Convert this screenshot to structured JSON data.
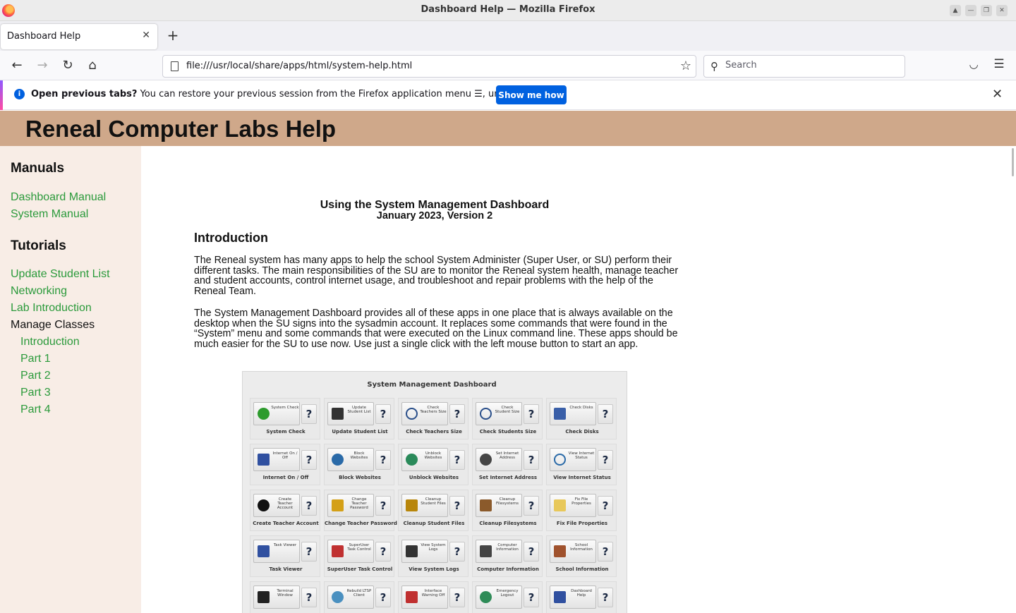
{
  "window": {
    "title": "Dashboard Help — Mozilla Firefox"
  },
  "tabs": [
    {
      "label": "Dashboard Help"
    }
  ],
  "navbar": {
    "url": "file:///usr/local/share/apps/html/system-help.html",
    "search_placeholder": "Search"
  },
  "notification": {
    "bold": "Open previous tabs?",
    "text": " You can restore your previous session from the Firefox application menu ☰, under History.",
    "button": "Show me how"
  },
  "page": {
    "banner_title": "Reneal Computer Labs Help",
    "sidebar": {
      "manuals_heading": "Manuals",
      "manuals": [
        "Dashboard Manual",
        "System Manual"
      ],
      "tutorials_heading": "Tutorials",
      "tutorials": [
        "Update Student List",
        "Networking",
        "Lab Introduction"
      ],
      "manage_classes": "Manage Classes",
      "manage_sub": [
        "Introduction",
        "Part 1",
        "Part 2",
        "Part 3",
        "Part 4"
      ]
    },
    "doc": {
      "title": "Using the System Management Dashboard",
      "subtitle": "January 2023, Version 2",
      "intro_heading": "Introduction",
      "para1": "The Reneal system has many apps to help the school System Administer (Super User, or SU) perform their different tasks.  The main responsibilities of the SU are to monitor the Reneal system health, manage teacher and student accounts, control internet usage, and troubleshoot and repair problems with the help of the Reneal Team.",
      "para2": "The System Management Dashboard provides all of these apps in one place that is always available on the desktop when the SU signs into the sysadmin account.  It replaces some commands that were found in the “System” menu and some commands that were executed on the Linux command line.  These apps should be much easier for the SU to use now.  Use just a single click with the left mouse button to start an app."
    },
    "dashboard": {
      "title": "System Management Dashboard",
      "help_glyph": "?",
      "apps": [
        {
          "button": "System Check",
          "caption": "System Check",
          "icon": "check-icon",
          "color": "#2e9b2e"
        },
        {
          "button": "Update Student List",
          "caption": "Update Student List",
          "icon": "list-icon",
          "color": "#333333"
        },
        {
          "button": "Check Teachers Size",
          "caption": "Check Teachers Size",
          "icon": "magnifier-icon",
          "color": "#2a4f8a"
        },
        {
          "button": "Check Student Size",
          "caption": "Check Students Size",
          "icon": "magnifier-icon",
          "color": "#2a4f8a"
        },
        {
          "button": "Check Disks",
          "caption": "Check Disks",
          "icon": "disk-icon",
          "color": "#3a5fa8"
        },
        {
          "button": "Internet On / Off",
          "caption": "Internet On / Off",
          "icon": "monitor-icon",
          "color": "#3050a0"
        },
        {
          "button": "Block Websites",
          "caption": "Block Websites",
          "icon": "globe-icon",
          "color": "#2a6aa8"
        },
        {
          "button": "Unblock Websites",
          "caption": "Unblock Websites",
          "icon": "globe-icon",
          "color": "#2a8a5a"
        },
        {
          "button": "Set Internet Address",
          "caption": "Set Internet Address",
          "icon": "router-icon",
          "color": "#444444"
        },
        {
          "button": "View Internet Status",
          "caption": "View Internet Status",
          "icon": "globe-search-icon",
          "color": "#2a6aa8"
        },
        {
          "button": "Create Teacher Account",
          "caption": "Create Teacher Account",
          "icon": "user-add-icon",
          "color": "#111111"
        },
        {
          "button": "Change Teacher Password",
          "caption": "Change Teacher Password",
          "icon": "lock-icon",
          "color": "#d4a017"
        },
        {
          "button": "Cleanup Student Files",
          "caption": "Cleanup Student Files",
          "icon": "broom-icon",
          "color": "#b8860b"
        },
        {
          "button": "Cleanup Filesystems",
          "caption": "Cleanup Filesystems",
          "icon": "broom-icon",
          "color": "#8b5a2b"
        },
        {
          "button": "Fix File Properties",
          "caption": "Fix File Properties",
          "icon": "file-icon",
          "color": "#e8c85a"
        },
        {
          "button": "Task Viewer",
          "caption": "Task Viewer",
          "icon": "monitor-icon",
          "color": "#3050a0"
        },
        {
          "button": "SuperUser Task Control",
          "caption": "SuperUser Task Control",
          "icon": "monitor-icon",
          "color": "#c03030"
        },
        {
          "button": "View System Logs",
          "caption": "View System Logs",
          "icon": "document-search-icon",
          "color": "#333333"
        },
        {
          "button": "Computer Information",
          "caption": "Computer Information",
          "icon": "computer-icon",
          "color": "#444444"
        },
        {
          "button": "School Information",
          "caption": "School Information",
          "icon": "document-icon",
          "color": "#a0522d"
        },
        {
          "button": "Terminal Window",
          "caption": "",
          "icon": "terminal-icon",
          "color": "#222222"
        },
        {
          "button": "Rebuild LTSP Client",
          "caption": "",
          "icon": "rebuild-icon",
          "color": "#4a90c0"
        },
        {
          "button": "Interface Warning Off",
          "caption": "",
          "icon": "warning-monitor-icon",
          "color": "#c03030"
        },
        {
          "button": "Emergency Logout",
          "caption": "",
          "icon": "logout-icon",
          "color": "#2e8b57"
        },
        {
          "button": "Dashboard Help",
          "caption": "",
          "icon": "help-book-icon",
          "color": "#3050a0"
        }
      ]
    }
  }
}
